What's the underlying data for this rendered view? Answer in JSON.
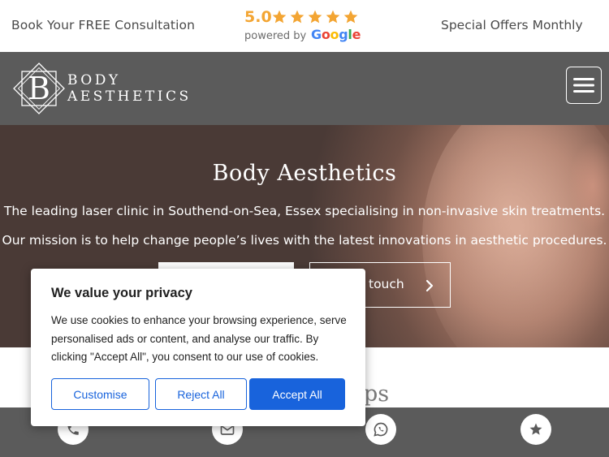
{
  "topbar": {
    "left_text": "Book Your FREE Consultation",
    "right_text": "Special Offers Monthly",
    "rating": {
      "score": "5.0",
      "star_count": 5,
      "powered_by": "powered by",
      "google_letters": [
        "G",
        "o",
        "o",
        "g",
        "l",
        "e"
      ],
      "google_colors": [
        "#4285F4",
        "#EA4335",
        "#FBBC05",
        "#4285F4",
        "#34A853",
        "#EA4335"
      ],
      "star_color": "#f3a533"
    }
  },
  "header": {
    "logo_letter": "B",
    "brand_line1": "BODY",
    "brand_line2": "AESTHETICS",
    "menu_icon": "hamburger-icon",
    "background": "#5b5b5b"
  },
  "hero": {
    "title": "Body Aesthetics",
    "line1": "The leading laser clinic in Southend-on-Sea, Essex specialising in non-invasive skin treatments.",
    "line2": "Our mission is to help change people’s lives with the latest innovations in aesthetic procedures.",
    "secondary_button_label": "touch",
    "secondary_button_icon": "chevron-right-icon"
  },
  "section": {
    "heading_partial": "eps"
  },
  "bottombar": {
    "buttons": [
      {
        "icon": "phone-icon"
      },
      {
        "icon": "mail-icon"
      },
      {
        "icon": "whatsapp-icon"
      },
      {
        "icon": "star-icon"
      }
    ]
  },
  "cookie": {
    "title": "We value your privacy",
    "body": "We use cookies to enhance your browsing experience, serve personalised ads or content, and analyse our traffic. By clicking \"Accept All\", you consent to our use of cookies.",
    "customise_label": "Customise",
    "reject_label": "Reject All",
    "accept_label": "Accept All",
    "accent_color": "#1863dc"
  }
}
